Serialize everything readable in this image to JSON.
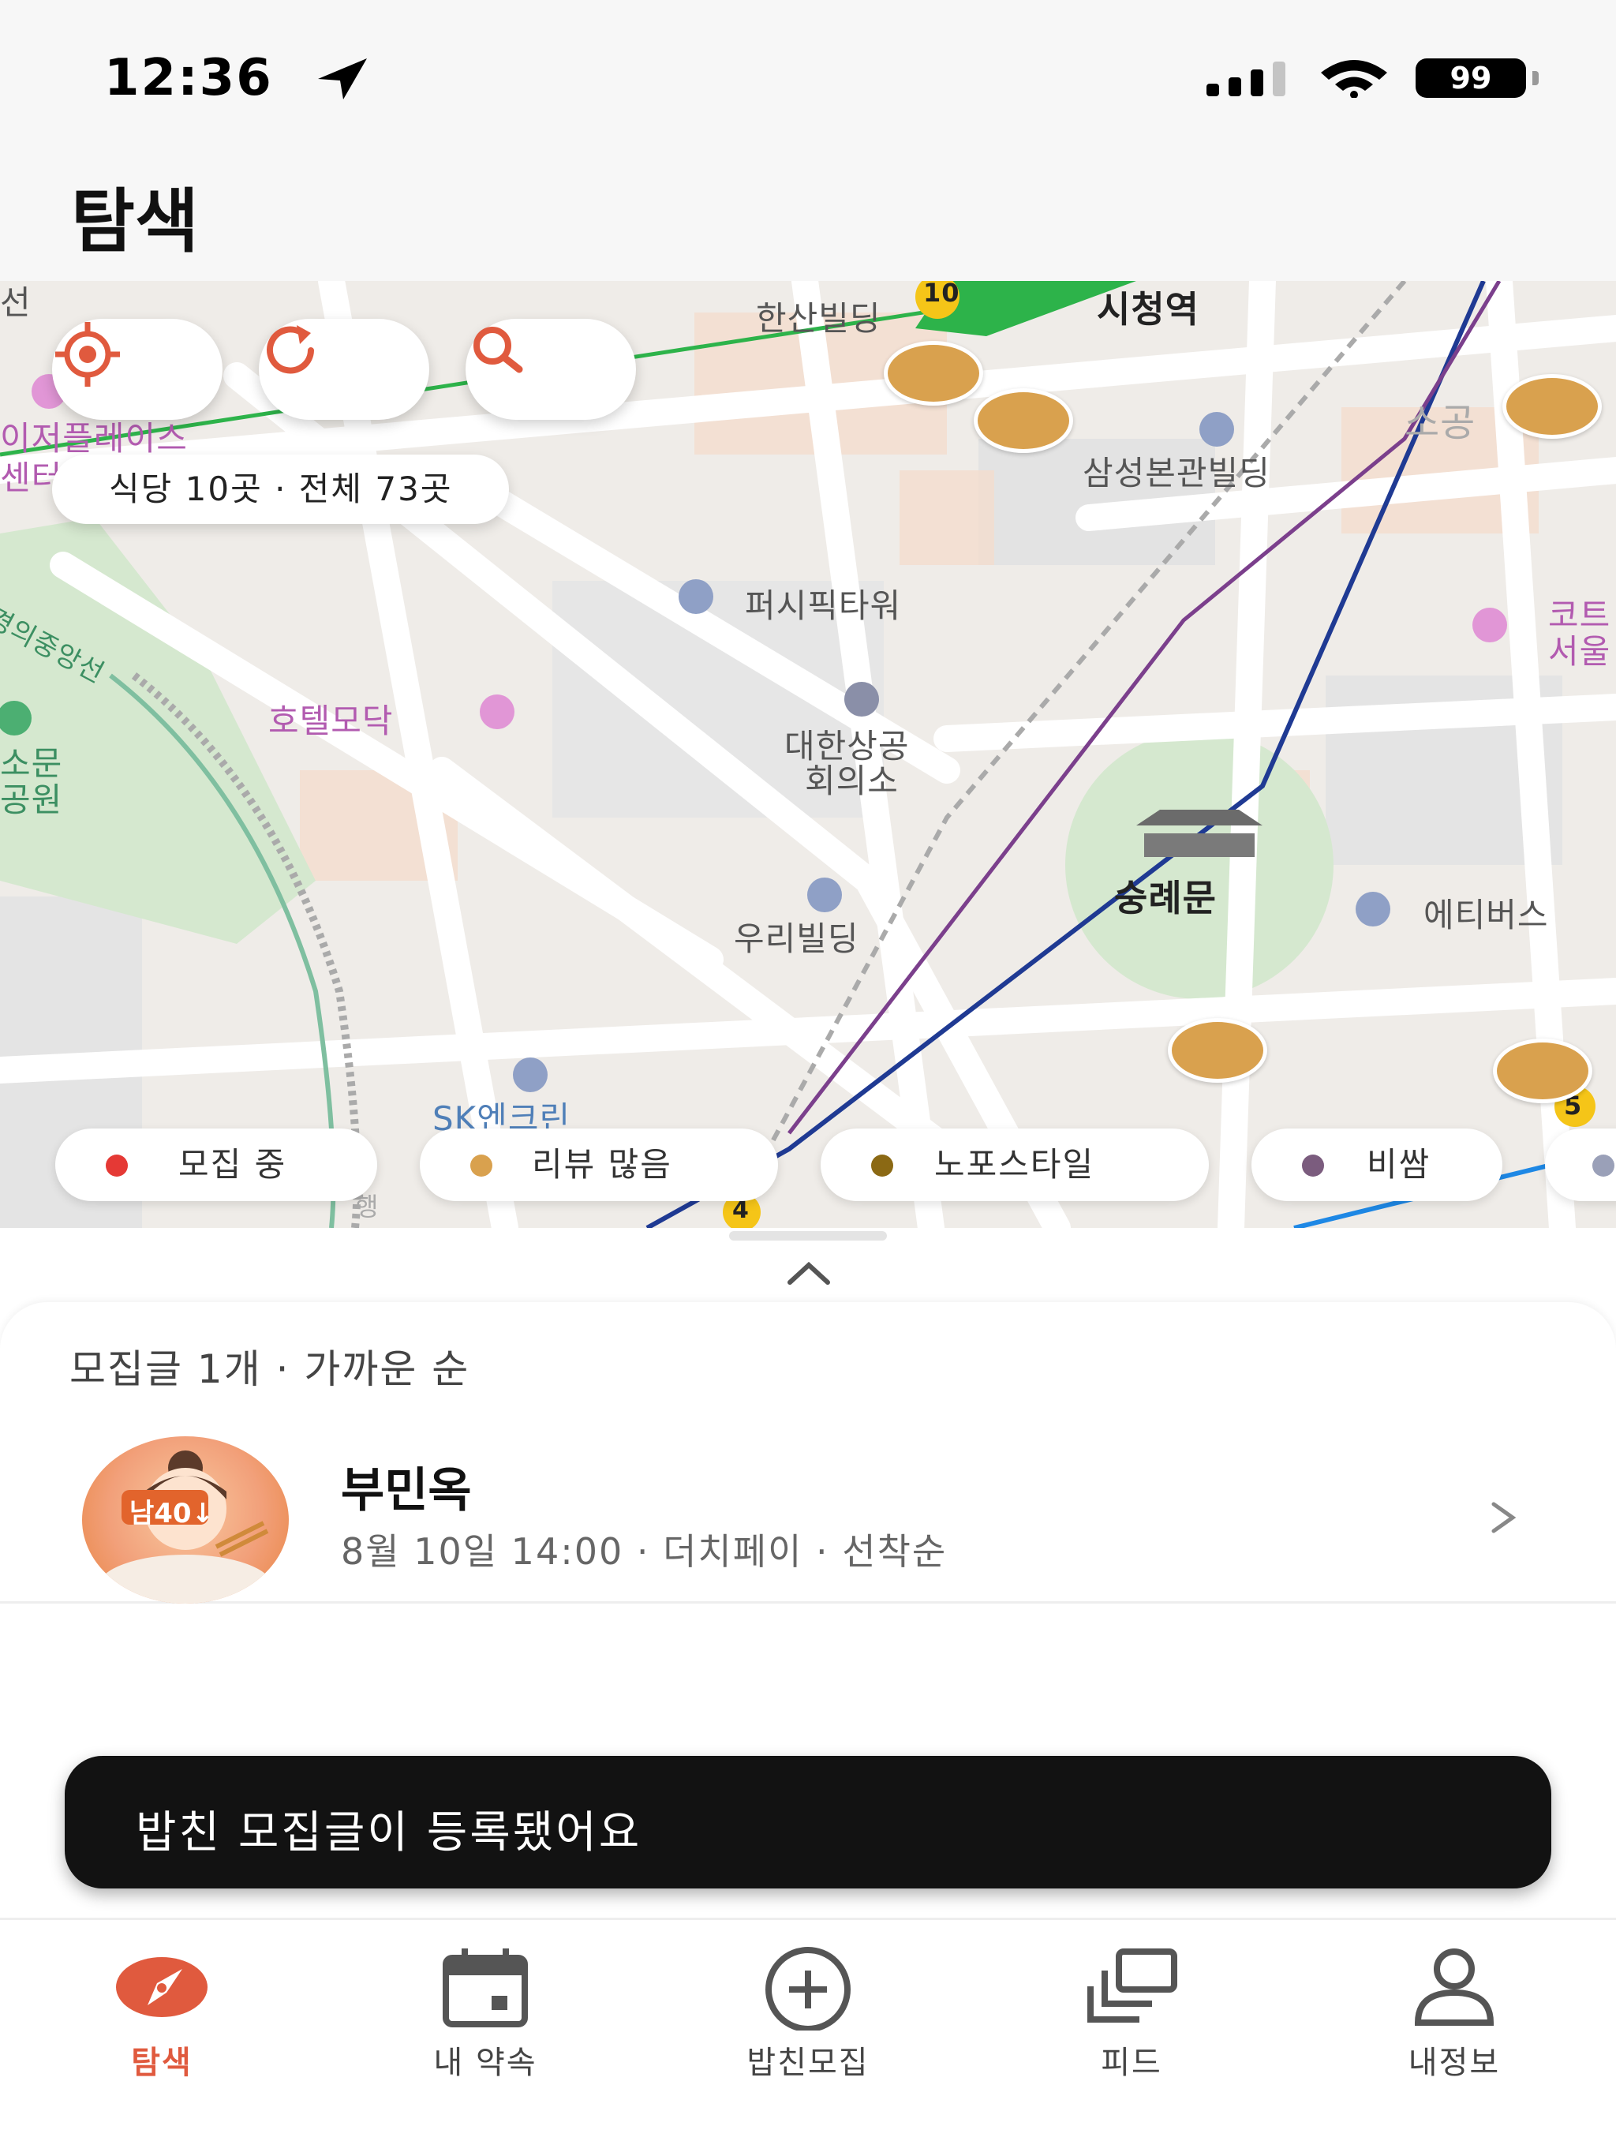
{
  "status_bar": {
    "time": "12:36",
    "battery": "99"
  },
  "header": {
    "title": "탐색"
  },
  "map": {
    "count_summary": "식당 10곳 · 전체 73곳",
    "labels": {
      "hansan": "한산빌딩",
      "cityhall": "시청역",
      "samsung": "삼성본관빌딩",
      "sogong": "소공",
      "place": "이저플레이스",
      "center": "센터",
      "pacific": "퍼시픽타워",
      "line": "경의중앙선",
      "hotel": "호텔모닥",
      "chamber_1": "대한상공",
      "chamber_2": "회의소",
      "park_1": "소문",
      "park_2": "공원",
      "korea_1": "코트",
      "korea_2": "서울",
      "woori": "우리빌딩",
      "sungnyemun": "숭례문",
      "etivers": "에티버스",
      "sk": "SK엔크린",
      "edge_top": "선",
      "edge_bottom": "행"
    },
    "badges": {
      "b10": "10",
      "b5": "5",
      "b4": "4"
    }
  },
  "legend": [
    {
      "label": "모집 중",
      "color": "#e53935"
    },
    {
      "label": "리뷰 많음",
      "color": "#d9a14e"
    },
    {
      "label": "노포스타일",
      "color": "#8b6914"
    },
    {
      "label": "비쌈",
      "color": "#7b5c7e"
    }
  ],
  "sheet": {
    "summary": "모집글 1개 · 가까운 순",
    "post": {
      "avatar_badge": "남40↓",
      "title": "부민옥",
      "meta": "8월 10일 14:00 · 더치페이 · 선착순"
    }
  },
  "toast": {
    "message": "밥친 모집글이 등록됐어요"
  },
  "tabs": [
    {
      "label": "탐색",
      "icon": "compass-icon"
    },
    {
      "label": "내 약속",
      "icon": "calendar-icon"
    },
    {
      "label": "밥친모집",
      "icon": "plus-circle-icon"
    },
    {
      "label": "피드",
      "icon": "cards-icon"
    },
    {
      "label": "내정보",
      "icon": "person-icon"
    }
  ],
  "colors": {
    "accent": "#e05a3e",
    "pin": "#d9a14e",
    "toast_bg": "#121212"
  }
}
